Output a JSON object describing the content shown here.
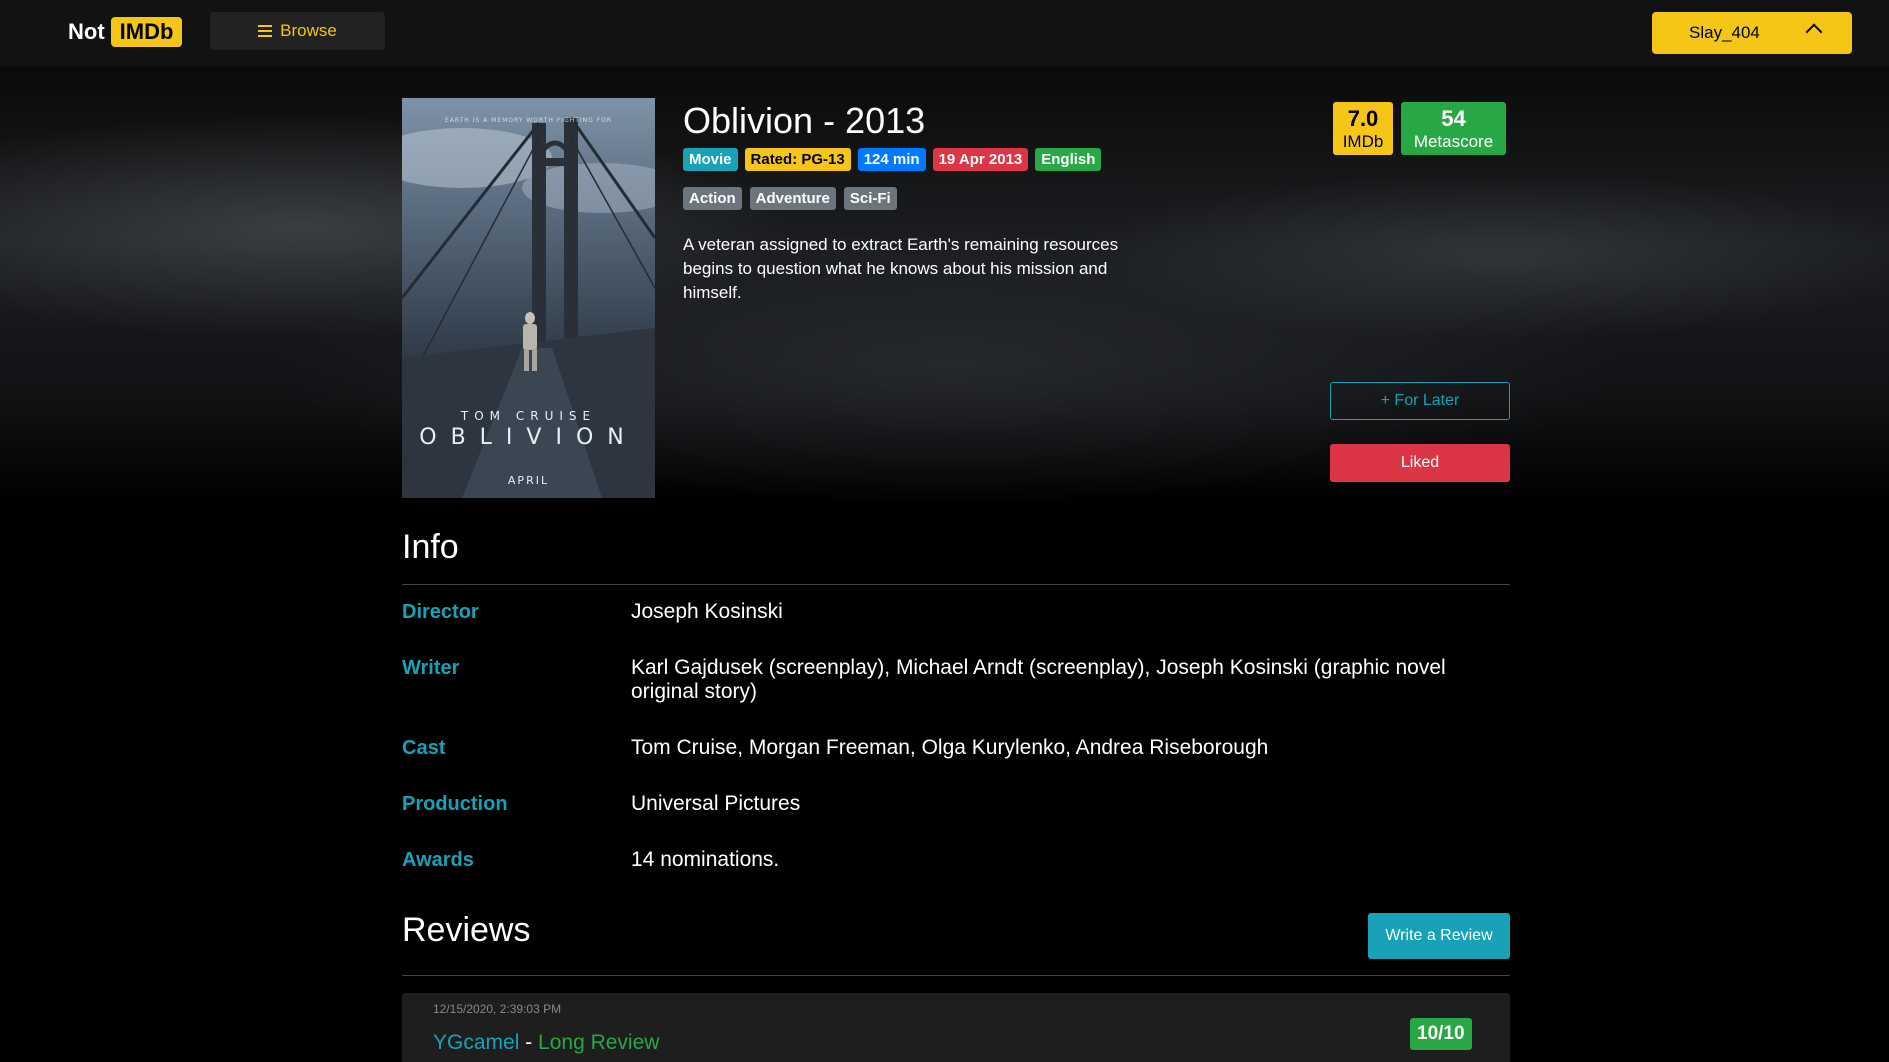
{
  "nav": {
    "brand_not": "Not",
    "brand_imdb": "IMDb",
    "browse_label": "Browse",
    "user_label": "Slay_404"
  },
  "movie": {
    "title": "Oblivion - 2013",
    "badges": {
      "type": "Movie",
      "rated": "Rated: PG-13",
      "runtime": "124 min",
      "release": "19 Apr 2013",
      "language": "English"
    },
    "genres": [
      "Action",
      "Adventure",
      "Sci-Fi"
    ],
    "plot": "A veteran assigned to extract Earth's remaining resources begins to question what he knows about his mission and himself.",
    "poster": {
      "tagline": "EARTH IS A MEMORY WORTH FIGHTING FOR",
      "actor": "TOM CRUISE",
      "title": "OBLIVION",
      "release": "APRIL"
    }
  },
  "scores": {
    "imdb_value": "7.0",
    "imdb_label": "IMDb",
    "meta_value": "54",
    "meta_label": "Metascore"
  },
  "actions": {
    "for_later": "+ For Later",
    "liked": "Liked"
  },
  "info": {
    "title": "Info",
    "rows": [
      {
        "label": "Director",
        "value": "Joseph Kosinski"
      },
      {
        "label": "Writer",
        "value": "Karl Gajdusek (screenplay), Michael Arndt (screenplay), Joseph Kosinski (graphic novel original story)"
      },
      {
        "label": "Cast",
        "value": "Tom Cruise, Morgan Freeman, Olga Kurylenko, Andrea Riseborough"
      },
      {
        "label": "Production",
        "value": "Universal Pictures"
      },
      {
        "label": "Awards",
        "value": "14 nominations."
      }
    ]
  },
  "reviews": {
    "title": "Reviews",
    "write_label": "Write a Review",
    "items": [
      {
        "timestamp": "12/15/2020, 2:39:03 PM",
        "user": "YGcamel",
        "separator": " - ",
        "type": "Long Review",
        "score": "10/10"
      }
    ]
  },
  "colors": {
    "accent_yellow": "#f5c518",
    "teal": "#17a2b8",
    "green": "#28a745",
    "red": "#dc3545",
    "blue": "#007bff",
    "gray": "#6c757d"
  }
}
